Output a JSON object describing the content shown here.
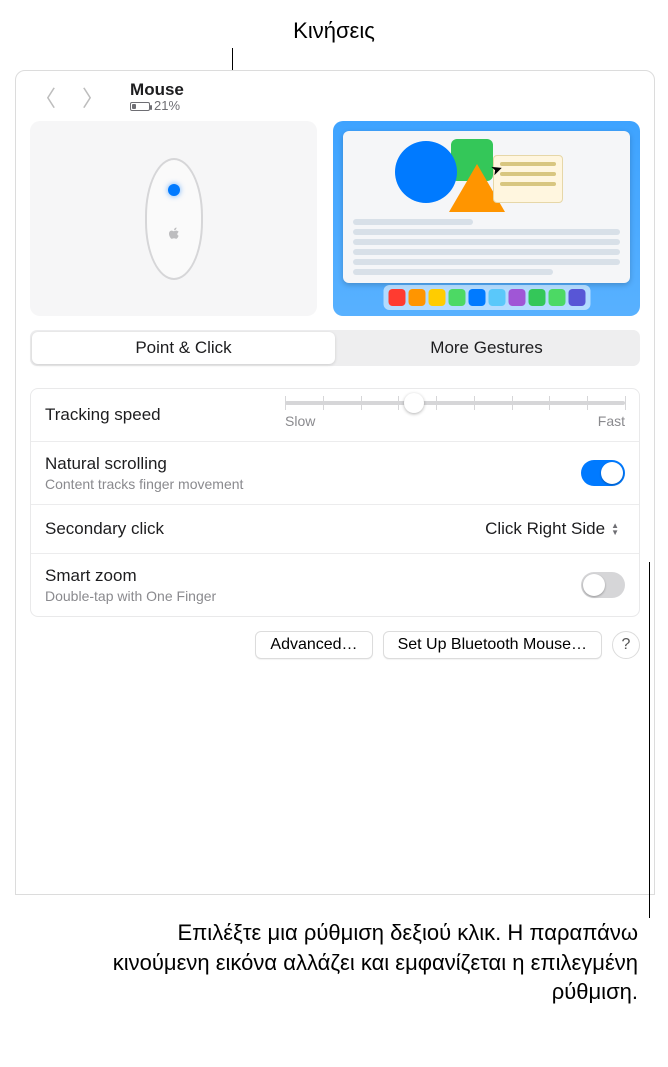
{
  "callouts": {
    "top": "Κινήσεις",
    "bottom": "Επιλέξτε μια ρύθμιση δεξιού κλικ. Η παραπάνω κινούμενη εικόνα αλλάζει και εμφανίζεται η επιλεγμένη ρύθμιση."
  },
  "header": {
    "title": "Mouse",
    "battery_pct": "21%"
  },
  "tabs": {
    "point_click": "Point & Click",
    "more_gestures": "More Gestures"
  },
  "tracking": {
    "label": "Tracking speed",
    "slow": "Slow",
    "fast": "Fast",
    "position_pct": 38
  },
  "natural_scrolling": {
    "label": "Natural scrolling",
    "sub": "Content tracks finger movement",
    "on": true
  },
  "secondary_click": {
    "label": "Secondary click",
    "value": "Click Right Side"
  },
  "smart_zoom": {
    "label": "Smart zoom",
    "sub": "Double-tap with One Finger",
    "on": false
  },
  "buttons": {
    "advanced": "Advanced…",
    "bluetooth": "Set Up Bluetooth Mouse…"
  },
  "dock_colors": [
    "#ff3b30",
    "#ff9500",
    "#ffcc00",
    "#4cd964",
    "#007aff",
    "#5ac8fa",
    "#a056d6",
    "#34c759",
    "#4cd964",
    "#5856d6"
  ]
}
